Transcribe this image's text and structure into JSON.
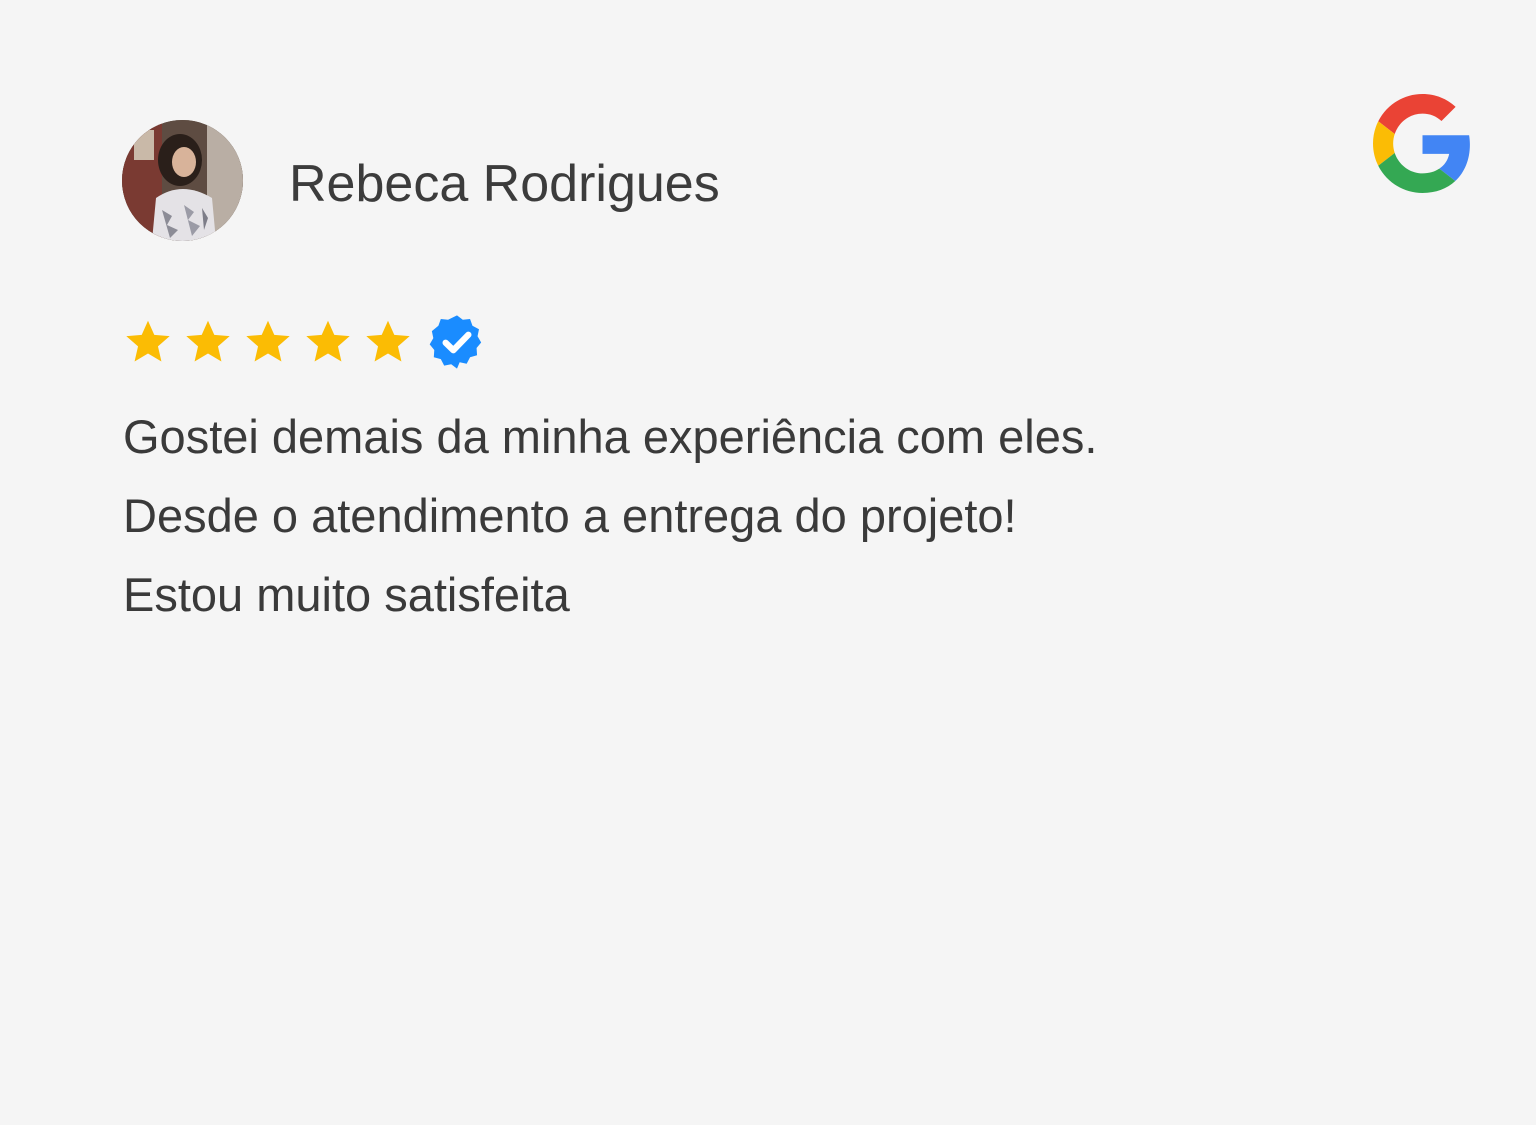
{
  "review": {
    "reviewer_name": "Rebeca Rodrigues",
    "rating": 5,
    "max_rating": 5,
    "verified": true,
    "text": "Gostei demais da minha experiência com eles. Desde o atendimento a entrega do projeto! Estou muito satisfeita"
  },
  "icons": {
    "source_logo": "google-logo-icon",
    "star": "star-icon",
    "verified": "verified-badge-icon",
    "avatar": "user-avatar"
  },
  "colors": {
    "background": "#f5f5f5",
    "star": "#fbbc04",
    "verified": "#1a8cff",
    "name_text": "#3c3c3c",
    "body_text": "#3a3a3a",
    "google_blue": "#4285f4",
    "google_red": "#ea4335",
    "google_yellow": "#fbbc05",
    "google_green": "#34a853"
  }
}
